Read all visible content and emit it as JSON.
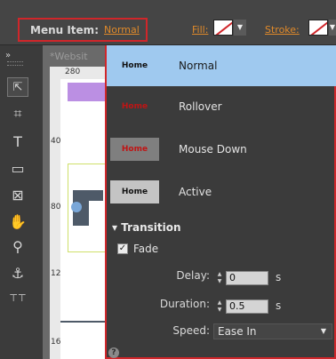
{
  "toolbar": {
    "menu_item_label": "Menu Item:",
    "menu_item_value": "Normal",
    "fill_label": "Fill:",
    "stroke_label": "Stroke:",
    "accent_color": "#d0262a",
    "link_color": "#e08a2a"
  },
  "document": {
    "tab_title": "*Websit",
    "ruler_top_number": "280",
    "ruler_left_numbers": [
      "40",
      "80",
      "120",
      "160"
    ]
  },
  "states_popup": {
    "states": [
      {
        "thumb_text": "Home",
        "name": "Normal",
        "selected": true
      },
      {
        "thumb_text": "Home",
        "name": "Rollover",
        "selected": false
      },
      {
        "thumb_text": "Home",
        "name": "Mouse Down",
        "selected": false
      },
      {
        "thumb_text": "Home",
        "name": "Active",
        "selected": false
      }
    ],
    "transition_header": "Transition",
    "fade_label": "Fade",
    "fade_checked": true,
    "delay_label": "Delay:",
    "delay_value": "0",
    "duration_label": "Duration:",
    "duration_value": "0.5",
    "seconds_unit": "s",
    "speed_label": "Speed:",
    "speed_value": "Ease In"
  },
  "icons": {
    "tools": [
      "double-chevron-icon",
      "selection-arrow-icon",
      "crop-icon",
      "text-tool-icon",
      "rectangle-tool-icon",
      "image-frame-icon",
      "hand-icon",
      "zoom-icon",
      "anchor-icon",
      "text-frame-icon"
    ],
    "popup": [
      "expand-triangle-icon",
      "stepper-icon",
      "dropdown-arrow-icon",
      "help-icon"
    ]
  }
}
